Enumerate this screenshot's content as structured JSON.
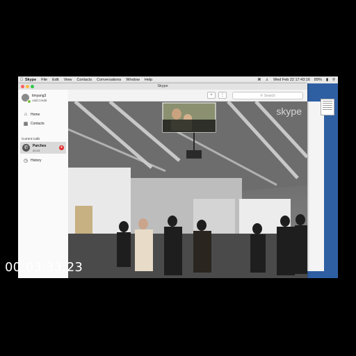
{
  "menubar": {
    "apple_icon": "apple-icon",
    "app": "Skype",
    "items": [
      "File",
      "Edit",
      "View",
      "Contacts",
      "Conversations",
      "Window",
      "Help"
    ],
    "clock": "Wed Feb 22  17:43:16",
    "battery": "89%"
  },
  "window": {
    "title": "Skype",
    "search_placeholder": "Search"
  },
  "sidebar": {
    "username": "timyang3",
    "add_credit": "Add Credit",
    "nav": [
      {
        "label": "Home",
        "icon": "home-icon"
      },
      {
        "label": "Contacts",
        "icon": "contacts-icon"
      }
    ],
    "current_calls_header": "Current Calls",
    "call": {
      "name": "Parches",
      "duration": "20:15"
    },
    "history": {
      "label": "History",
      "icon": "history-icon"
    }
  },
  "video": {
    "watermark": "skype"
  },
  "overlay": {
    "timecode": "00:03:33;23"
  },
  "colors": {
    "desktop": "#2f5fa3",
    "end_call": "#e32b2b",
    "online": "#7ac142"
  }
}
